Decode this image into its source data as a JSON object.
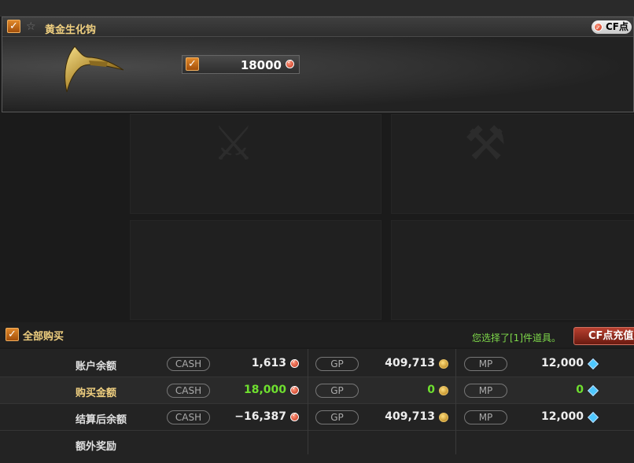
{
  "item": {
    "name": "黄金生化钩",
    "currency_chip": "CF点",
    "price": "18000"
  },
  "buy_all": {
    "label": "全部购买",
    "selected_info": "您选择了[1]件道具。",
    "recharge_label": "CF点充值"
  },
  "balance": {
    "rows": [
      {
        "label": "账户余额",
        "cash_tag": "CASH",
        "cash": "1,613",
        "gp_tag": "GP",
        "gp": "409,713",
        "mp_tag": "MP",
        "mp": "12,000"
      },
      {
        "label": "购买金额",
        "cash_tag": "CASH",
        "cash": "18,000",
        "gp_tag": "GP",
        "gp": "0",
        "mp_tag": "MP",
        "mp": "0"
      },
      {
        "label": "结算后余额",
        "cash_tag": "CASH",
        "cash": "−16,387",
        "gp_tag": "GP",
        "gp": "409,713",
        "mp_tag": "MP",
        "mp": "12,000"
      },
      {
        "label": "额外奖励"
      }
    ]
  },
  "colors": {
    "accent": "#e0882a",
    "label_gold": "#f0d080",
    "green": "#6fe02f",
    "info_green": "#7ed84a"
  },
  "icons": [
    "checkbox-checked-icon",
    "star-icon",
    "cf-coin-icon",
    "gp-coin-icon",
    "mp-gem-icon",
    "weapon-icon"
  ]
}
